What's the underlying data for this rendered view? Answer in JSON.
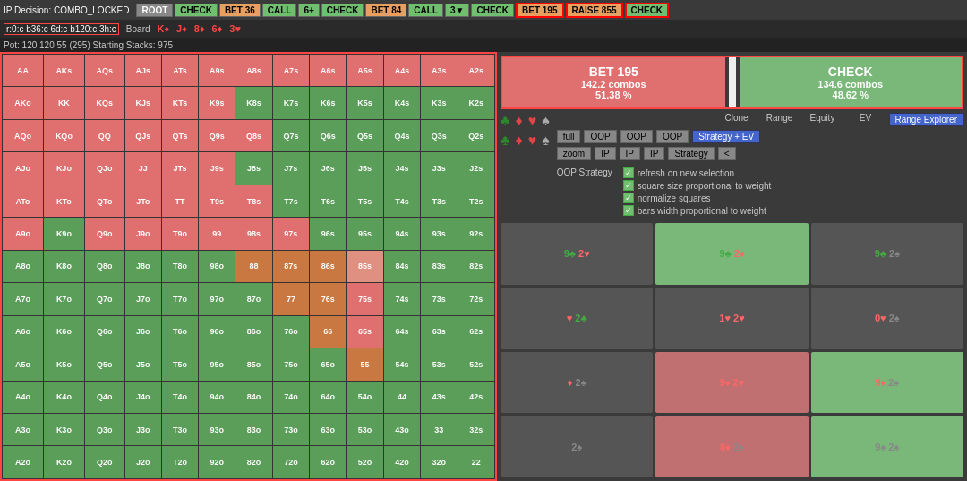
{
  "header": {
    "ip_decision": "IP Decision: COMBO_LOCKED",
    "range_path": "r:0:c b36:c 6d:c b120:c 3h:c"
  },
  "top_bar": {
    "buttons": [
      {
        "label": "ROOT",
        "class": "btn-root"
      },
      {
        "label": "CHECK",
        "class": "btn-check"
      },
      {
        "label": "BET 36",
        "class": "btn-bet36"
      },
      {
        "label": "CALL",
        "class": "btn-call"
      },
      {
        "label": "6+",
        "class": "btn-6plus"
      },
      {
        "label": "CHECK",
        "class": "btn-check2"
      },
      {
        "label": "BET 84",
        "class": "btn-bet84"
      },
      {
        "label": "CALL",
        "class": "btn-call2"
      },
      {
        "label": "3▼",
        "class": "btn-3v"
      },
      {
        "label": "CHECK",
        "class": "btn-check2"
      },
      {
        "label": "BET 195",
        "class": "btn-bet195"
      },
      {
        "label": "RAISE 855",
        "class": "btn-raise855"
      },
      {
        "label": "CHECK",
        "class": "btn-check3"
      }
    ]
  },
  "board": {
    "label": "Board",
    "cards": [
      "K♦",
      "J♦",
      "8♦",
      "6♦",
      "3♥"
    ]
  },
  "pot": {
    "text": "Pot: 120  120 55 (295)  Starting Stacks: 975"
  },
  "action_summary": {
    "bet": {
      "action": "BET 195",
      "combos": "142.2 combos",
      "pct": "51.38 %"
    },
    "check": {
      "action": "CHECK",
      "combos": "134.6 combos",
      "pct": "48.62 %"
    }
  },
  "controls": {
    "clone_label": "Clone",
    "range_label": "Range",
    "equity_label": "Equity",
    "ev_label": "EV",
    "range_explorer_label": "Range Explorer",
    "full_label": "full",
    "oop_label": "OOP",
    "zoom_label": "zoom",
    "ip_label": "IP",
    "strategy_ev_label": "Strategy + EV",
    "strategy_label": "Strategy",
    "arrow_label": "<"
  },
  "oop_strategy_label": "OOP Strategy",
  "checkboxes": [
    "refresh on new selection",
    "square size proportional to weight",
    "normalize squares",
    "bars width proportional to weight"
  ],
  "card_cells": [
    {
      "label": "9♣ 2♥",
      "class": "card-cell"
    },
    {
      "label": "9♣ 2♦",
      "class": "card-cell-highlight"
    },
    {
      "label": "9♣ 2♠",
      "class": "card-cell"
    },
    {
      "label": "♥ 2♣",
      "class": "card-cell"
    },
    {
      "label": "1♥ 2♥",
      "class": "card-cell"
    },
    {
      "label": "0♥ 2♠",
      "class": "card-cell"
    },
    {
      "label": "♦ 2♠",
      "class": "card-cell"
    },
    {
      "label": "9♦ 2♥",
      "class": "card-cell-salmon"
    },
    {
      "label": "9♦ 2♠",
      "class": "card-cell-highlight"
    },
    {
      "label": "2♠",
      "class": "card-cell"
    },
    {
      "label": "8♦ 2♠",
      "class": "card-cell-salmon"
    },
    {
      "label": "9♠ 2♠",
      "class": "card-cell-highlight"
    }
  ],
  "grid_cells": [
    [
      "AA",
      "AKs",
      "AQs",
      "AJs",
      "ATs",
      "A9s",
      "A8s",
      "A7s",
      "A6s",
      "A5s",
      "A4s",
      "A3s",
      "A2s"
    ],
    [
      "AKo",
      "KK",
      "KQs",
      "KJs",
      "KTs",
      "K9s",
      "K8s",
      "K7s",
      "K6s",
      "K5s",
      "K4s",
      "K3s",
      "K2s"
    ],
    [
      "AQo",
      "KQo",
      "QQ",
      "QJs",
      "QTs",
      "Q9s",
      "Q8s",
      "Q7s",
      "Q6s",
      "Q5s",
      "Q4s",
      "Q3s",
      "Q2s"
    ],
    [
      "AJo",
      "KJo",
      "QJo",
      "JJ",
      "JTs",
      "J9s",
      "J8s",
      "J7s",
      "J6s",
      "J5s",
      "J4s",
      "J3s",
      "J2s"
    ],
    [
      "ATo",
      "KTo",
      "QTo",
      "JTo",
      "TT",
      "T9s",
      "T8s",
      "T7s",
      "T6s",
      "T5s",
      "T4s",
      "T3s",
      "T2s"
    ],
    [
      "A9o",
      "K9o",
      "Q9o",
      "J9o",
      "T9o",
      "99",
      "98s",
      "97s",
      "96s",
      "95s",
      "94s",
      "93s",
      "92s"
    ],
    [
      "A8o",
      "K8o",
      "Q8o",
      "J8o",
      "T8o",
      "98o",
      "88",
      "87s",
      "86s",
      "85s",
      "84s",
      "83s",
      "82s"
    ],
    [
      "A7o",
      "K7o",
      "Q7o",
      "J7o",
      "T7o",
      "97o",
      "87o",
      "77",
      "76s",
      "75s",
      "74s",
      "73s",
      "72s"
    ],
    [
      "A6o",
      "K6o",
      "Q6o",
      "J6o",
      "T6o",
      "96o",
      "86o",
      "76o",
      "66",
      "65s",
      "64s",
      "63s",
      "62s"
    ],
    [
      "A5o",
      "K5o",
      "Q5o",
      "J5o",
      "T5o",
      "95o",
      "85o",
      "75o",
      "65o",
      "55",
      "54s",
      "53s",
      "52s"
    ],
    [
      "A4o",
      "K4o",
      "Q4o",
      "J4o",
      "T4o",
      "94o",
      "84o",
      "74o",
      "64o",
      "54o",
      "44",
      "43s",
      "42s"
    ],
    [
      "A3o",
      "K3o",
      "Q3o",
      "J3o",
      "T3o",
      "93o",
      "83o",
      "73o",
      "63o",
      "53o",
      "43o",
      "33",
      "32s"
    ],
    [
      "A2o",
      "K2o",
      "Q2o",
      "J2o",
      "T2o",
      "92o",
      "82o",
      "72o",
      "62o",
      "52o",
      "42o",
      "32o",
      "22"
    ]
  ],
  "cell_colors": {
    "AA": "c-salmon",
    "AKs": "c-salmon",
    "AQs": "c-salmon",
    "AJs": "c-salmon",
    "ATs": "c-salmon",
    "A9s": "c-salmon",
    "A8s": "c-salmon",
    "A7s": "c-salmon",
    "A6s": "c-salmon",
    "A5s": "c-salmon",
    "A4s": "c-salmon",
    "A3s": "c-salmon",
    "A2s": "c-salmon",
    "AKo": "c-salmon",
    "KK": "c-salmon",
    "KQs": "c-salmon",
    "KJs": "c-salmon",
    "KTs": "c-salmon",
    "K9s": "c-salmon",
    "K8s": "c-green",
    "K7s": "c-green",
    "K6s": "c-green",
    "K5s": "c-green",
    "K4s": "c-green",
    "K3s": "c-green",
    "K2s": "c-green",
    "AQo": "c-salmon",
    "KQo": "c-salmon",
    "QQ": "c-salmon",
    "QJs": "c-salmon",
    "QTs": "c-salmon",
    "Q9s": "c-salmon",
    "Q8s": "c-salmon",
    "Q7s": "c-green",
    "Q6s": "c-green",
    "Q5s": "c-green",
    "Q4s": "c-green",
    "Q3s": "c-green",
    "Q2s": "c-green",
    "AJo": "c-salmon",
    "KJo": "c-salmon",
    "QJo": "c-salmon",
    "JJ": "c-salmon",
    "JTs": "c-salmon",
    "J9s": "c-salmon",
    "J8s": "c-green",
    "J7s": "c-green",
    "J6s": "c-green",
    "J5s": "c-green",
    "J4s": "c-green",
    "J3s": "c-green",
    "J2s": "c-green",
    "ATo": "c-salmon",
    "KTo": "c-salmon",
    "QTo": "c-salmon",
    "JTo": "c-salmon",
    "TT": "c-salmon",
    "T9s": "c-salmon",
    "T8s": "c-salmon",
    "T7s": "c-green",
    "T6s": "c-green",
    "T5s": "c-green",
    "T4s": "c-green",
    "T3s": "c-green",
    "T2s": "c-green",
    "A9o": "c-salmon",
    "K9o": "c-green",
    "Q9o": "c-salmon",
    "J9o": "c-salmon",
    "T9o": "c-salmon",
    "99": "c-salmon",
    "98s": "c-salmon",
    "97s": "c-salmon",
    "96s": "c-green",
    "95s": "c-green",
    "94s": "c-green",
    "93s": "c-green",
    "92s": "c-green",
    "A8o": "c-green",
    "K8o": "c-green",
    "Q8o": "c-green",
    "J8o": "c-green",
    "T8o": "c-green",
    "98o": "c-green",
    "88": "c-orange",
    "87s": "c-orange",
    "86s": "c-orange",
    "85s": "c-salmon",
    "84s": "c-green",
    "83s": "c-green",
    "82s": "c-green",
    "A7o": "c-green",
    "K7o": "c-green",
    "Q7o": "c-green",
    "J7o": "c-green",
    "T7o": "c-green",
    "97o": "c-green",
    "87o": "c-green",
    "77": "c-orange",
    "76s": "c-orange",
    "75s": "c-salmon",
    "74s": "c-green",
    "73s": "c-green",
    "72s": "c-green",
    "A6o": "c-green",
    "K6o": "c-green",
    "Q6o": "c-green",
    "J6o": "c-green",
    "T6o": "c-green",
    "96o": "c-green",
    "86o": "c-green",
    "76o": "c-green",
    "66": "c-orange",
    "65s": "c-salmon",
    "64s": "c-green",
    "63s": "c-green",
    "62s": "c-green",
    "A5o": "c-green",
    "K5o": "c-green",
    "Q5o": "c-green",
    "J5o": "c-green",
    "T5o": "c-green",
    "95o": "c-green",
    "85o": "c-green",
    "75o": "c-green",
    "65o": "c-green",
    "55": "c-orange",
    "54s": "c-green",
    "53s": "c-green",
    "52s": "c-green",
    "A4o": "c-green",
    "K4o": "c-green",
    "Q4o": "c-green",
    "J4o": "c-green",
    "T4o": "c-green",
    "94o": "c-green",
    "84o": "c-green",
    "74o": "c-green",
    "64o": "c-green",
    "54o": "c-green",
    "44": "c-green",
    "43s": "c-green",
    "42s": "c-green",
    "A3o": "c-green",
    "K3o": "c-green",
    "Q3o": "c-green",
    "J3o": "c-green",
    "T3o": "c-green",
    "93o": "c-green",
    "83o": "c-green",
    "73o": "c-green",
    "63o": "c-green",
    "53o": "c-green",
    "43o": "c-green",
    "33": "c-green",
    "32s": "c-green",
    "A2o": "c-green",
    "K2o": "c-green",
    "Q2o": "c-green",
    "J2o": "c-green",
    "T2o": "c-green",
    "92o": "c-green",
    "82o": "c-green",
    "72o": "c-green",
    "62o": "c-green",
    "52o": "c-green",
    "42o": "c-green",
    "32o": "c-green",
    "22": "c-green"
  }
}
